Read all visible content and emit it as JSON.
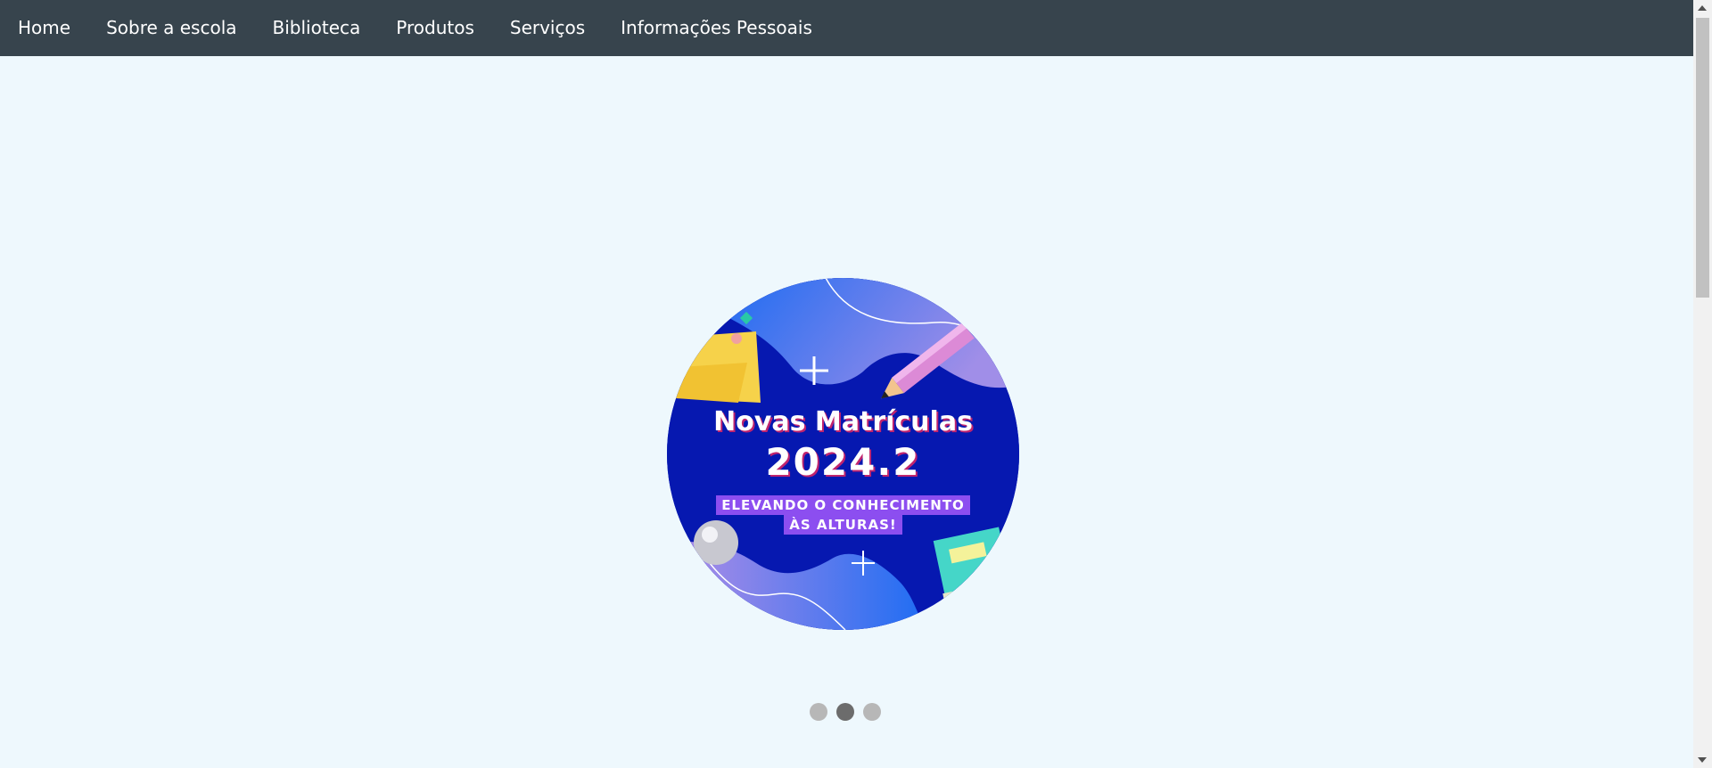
{
  "nav": {
    "items": [
      {
        "label": "Home"
      },
      {
        "label": "Sobre a escola"
      },
      {
        "label": "Biblioteca"
      },
      {
        "label": "Produtos"
      },
      {
        "label": "Serviços"
      },
      {
        "label": "Informações Pessoais"
      }
    ]
  },
  "carousel": {
    "slide": {
      "title_line1": "Novas Matrículas",
      "title_line2": "2024.2",
      "subtitle_line1": "ELEVANDO O CONHECIMENTO",
      "subtitle_line2": "ÀS ALTURAS!"
    },
    "dots_count": 3,
    "active_index": 1
  },
  "colors": {
    "navbar": "#37444d",
    "page_background": "#eef8fd",
    "slide_background": "#0618b0",
    "dot_inactive": "#b7b7b7",
    "dot_active": "#6c6c6c"
  }
}
